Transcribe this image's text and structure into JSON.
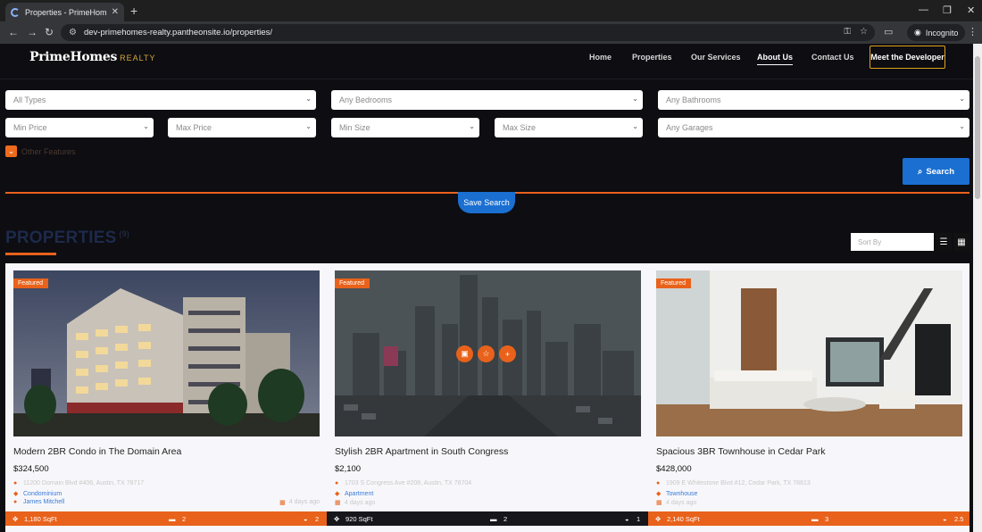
{
  "browser": {
    "tab_title": "Properties - PrimeHomes Realty",
    "url": "dev-primehomes-realty.pantheonsite.io/properties/",
    "incognito_label": "Incognito"
  },
  "nav": {
    "brand": "PrimeHomes",
    "brand_suffix": "REALTY",
    "items": [
      "Home",
      "Properties",
      "Our Services",
      "About Us",
      "Contact Us"
    ],
    "cta": "Meet the Developer"
  },
  "filters": {
    "type": "All Types",
    "bedrooms": "Any Bedrooms",
    "bathrooms": "Any Bathrooms",
    "min_price": "Min Price",
    "max_price": "Max Price",
    "min_size": "Min Size",
    "max_size": "Max Size",
    "garages": "Any Garages",
    "other_features": "Other Features",
    "search": "Search",
    "save_search": "Save Search"
  },
  "listing": {
    "heading": "PROPERTIES",
    "count": "(9)",
    "sort_placeholder": "Sort By"
  },
  "properties": [
    {
      "badge": "Featured",
      "title": "Modern 2BR Condo in The Domain Area",
      "price": "$324,500",
      "address": "11200 Domain Blvd #406, Austin, TX 78717",
      "type": "Condominium",
      "agent": "James Mitchell",
      "ago": "4 days ago",
      "sqft": "1,180 SqFt",
      "beds": "2",
      "baths": "2"
    },
    {
      "badge": "Featured",
      "title": "Stylish 2BR Apartment in South Congress",
      "price": "$2,100",
      "address": "1703 S Congress Ave #208, Austin, TX 78704",
      "type": "Apartment",
      "agent": "",
      "ago": "4 days ago",
      "sqft": "920 SqFt",
      "beds": "2",
      "baths": "1"
    },
    {
      "badge": "Featured",
      "title": "Spacious 3BR Townhouse in Cedar Park",
      "price": "$428,000",
      "address": "1909 E Whitestone Blvd #12, Cedar Park, TX 78613",
      "type": "Townhouse",
      "agent": "",
      "ago": "4 days ago",
      "sqft": "2,140 SqFt",
      "beds": "3",
      "baths": "2.5"
    }
  ],
  "colors": {
    "accent": "#e8621b",
    "primary_blue": "#1a6fd1",
    "gold": "#d4a73d",
    "background": "#0d0d12"
  }
}
